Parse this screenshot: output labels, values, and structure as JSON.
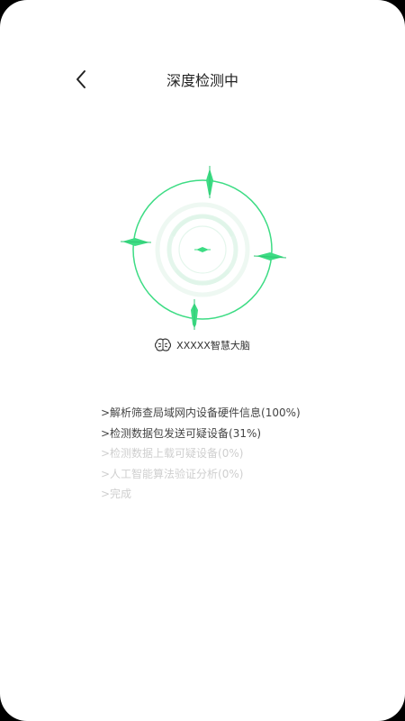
{
  "header": {
    "title": "深度检测中",
    "back_icon": "chevron-left-icon"
  },
  "colors": {
    "accent": "#3ddc84",
    "accent_light": "#e8f8ef",
    "text_dark": "#444444",
    "text_faint": "#cfcfcf"
  },
  "scanner": {
    "icon": "radar-scanner-icon"
  },
  "brand": {
    "icon": "brain-icon",
    "label": "XXXXX智慧大脑"
  },
  "steps": [
    {
      "text": ">解析筛查局域网内设备硬件信息(100%)",
      "state": "done"
    },
    {
      "text": ">检测数据包发送可疑设备(31%)",
      "state": "active"
    },
    {
      "text": ">检测数据上载可疑设备(0%)",
      "state": "pending"
    },
    {
      "text": ">人工智能算法验证分析(0%)",
      "state": "pending"
    },
    {
      "text": ">完成",
      "state": "pending"
    }
  ]
}
